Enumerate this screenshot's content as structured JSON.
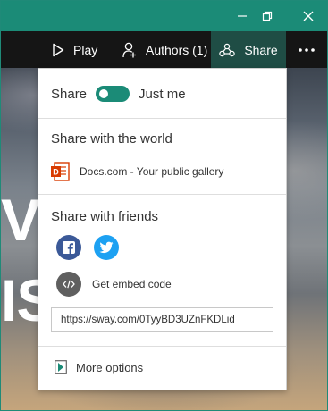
{
  "window": {
    "min_icon": "minimize-icon",
    "restore_icon": "restore-icon",
    "close_icon": "close-icon",
    "accent_color": "#1b8b77"
  },
  "appbar": {
    "play_label": "Play",
    "authors_label": "Authors (1)",
    "share_label": "Share",
    "more_icon": "ellipsis-icon"
  },
  "background": {
    "text_line1": "VS",
    "text_line2": "IS"
  },
  "share_panel": {
    "share_label": "Share",
    "toggle_state": "on",
    "scope_label": "Just me",
    "world_heading": "Share with the world",
    "gallery_label": "Docs.com - Your public gallery",
    "friends_heading": "Share with friends",
    "facebook_icon": "facebook-icon",
    "twitter_icon": "twitter-icon",
    "embed_label": "Get embed code",
    "link_value": "https://sway.com/0TyyBD3UZnFKDLid",
    "more_options_label": "More options",
    "facebook_color": "#3b5998",
    "twitter_color": "#1da1f2",
    "docs_color": "#d83b01"
  }
}
